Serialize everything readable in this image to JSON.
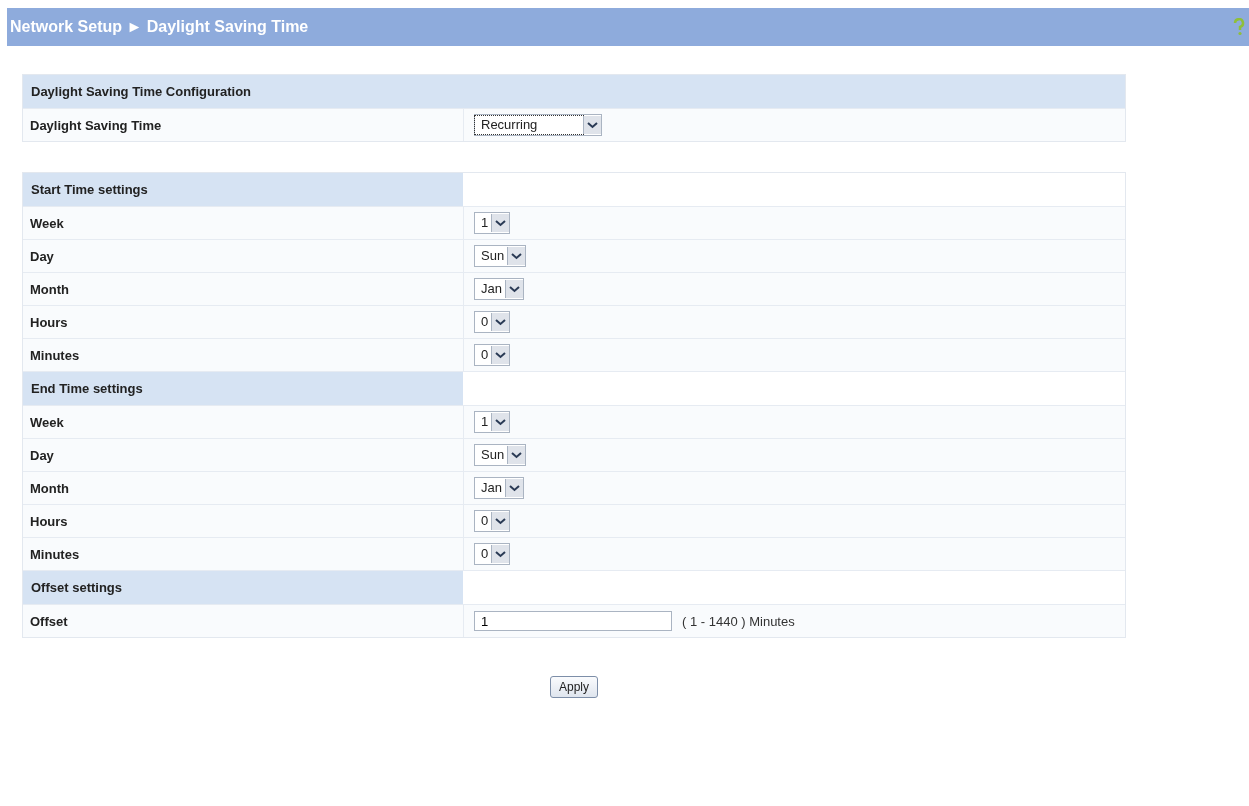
{
  "header": {
    "title": "Network Setup ► Daylight Saving Time"
  },
  "config": {
    "title": "Daylight Saving Time Configuration",
    "rows": [
      {
        "label": "Daylight Saving Time",
        "kind": "select",
        "value": "Recurring",
        "focused": true
      }
    ]
  },
  "sections": [
    {
      "title": "Start Time settings",
      "rows": [
        {
          "label": "Week",
          "kind": "select",
          "value": "1",
          "focused": false
        },
        {
          "label": "Day",
          "kind": "select",
          "value": "Sun",
          "focused": false
        },
        {
          "label": "Month",
          "kind": "select",
          "value": "Jan",
          "focused": false
        },
        {
          "label": "Hours",
          "kind": "select",
          "value": "0",
          "focused": false
        },
        {
          "label": "Minutes",
          "kind": "select",
          "value": "0",
          "focused": false
        }
      ]
    },
    {
      "title": "End Time settings",
      "rows": [
        {
          "label": "Week",
          "kind": "select",
          "value": "1",
          "focused": false
        },
        {
          "label": "Day",
          "kind": "select",
          "value": "Sun",
          "focused": false
        },
        {
          "label": "Month",
          "kind": "select",
          "value": "Jan",
          "focused": false
        },
        {
          "label": "Hours",
          "kind": "select",
          "value": "0",
          "focused": false
        },
        {
          "label": "Minutes",
          "kind": "select",
          "value": "0",
          "focused": false
        }
      ]
    },
    {
      "title": "Offset settings",
      "rows": [
        {
          "label": "Offset",
          "kind": "input",
          "value": "1",
          "hint": "( 1 - 1440 ) Minutes"
        }
      ]
    }
  ],
  "apply": {
    "label": "Apply"
  }
}
